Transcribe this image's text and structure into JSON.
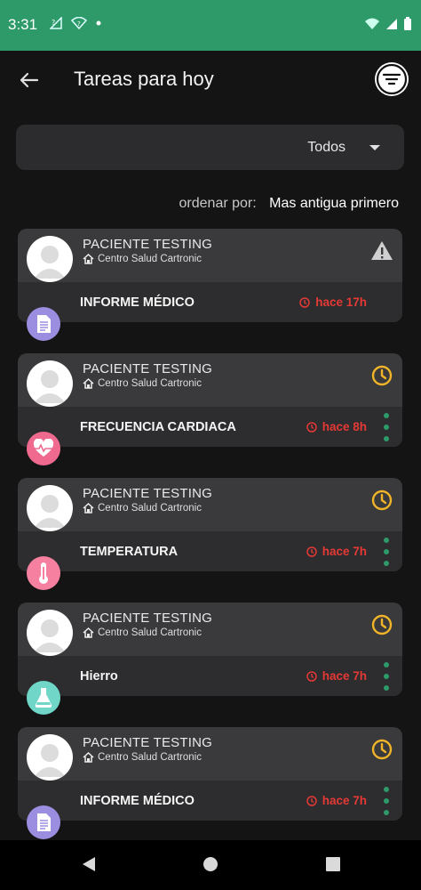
{
  "status_bar": {
    "time": "3:31"
  },
  "app_bar": {
    "title": "Tareas para hoy"
  },
  "filter": {
    "selected": "Todos"
  },
  "sort": {
    "label": "ordenar por:",
    "value": "Mas antigua primero"
  },
  "colors": {
    "accent_green": "#2e9a6a",
    "alert_red": "#e53935",
    "pending_yellow": "#f0b429"
  },
  "tasks": [
    {
      "patient": "PACIENTE TESTING",
      "center": "Centro Salud Cartronic",
      "task": "INFORME MÉDICO",
      "time": "hace 17h",
      "status": "warning-icon",
      "type_icon": "document-icon",
      "type_color": "#9b8ee0",
      "has_menu": false
    },
    {
      "patient": "PACIENTE TESTING",
      "center": "Centro Salud Cartronic",
      "task": "FRECUENCIA CARDIACA",
      "time": "hace 8h",
      "status": "clock-icon",
      "type_icon": "heart-rate-icon",
      "type_color": "#f06a8f",
      "has_menu": true
    },
    {
      "patient": "PACIENTE TESTING",
      "center": "Centro Salud Cartronic",
      "task": "TEMPERATURA",
      "time": "hace 7h",
      "status": "clock-icon",
      "type_icon": "thermometer-icon",
      "type_color": "#f5809f",
      "has_menu": true
    },
    {
      "patient": "PACIENTE TESTING",
      "center": "Centro Salud Cartronic",
      "task": "Hierro",
      "time": "hace 7h",
      "status": "clock-icon",
      "type_icon": "flask-icon",
      "type_color": "#6fd6c8",
      "has_menu": true
    },
    {
      "patient": "PACIENTE TESTING",
      "center": "Centro Salud Cartronic",
      "task": "INFORME MÉDICO",
      "time": "hace 7h",
      "status": "clock-icon",
      "type_icon": "document-icon",
      "type_color": "#9b8ee0",
      "has_menu": true
    }
  ]
}
